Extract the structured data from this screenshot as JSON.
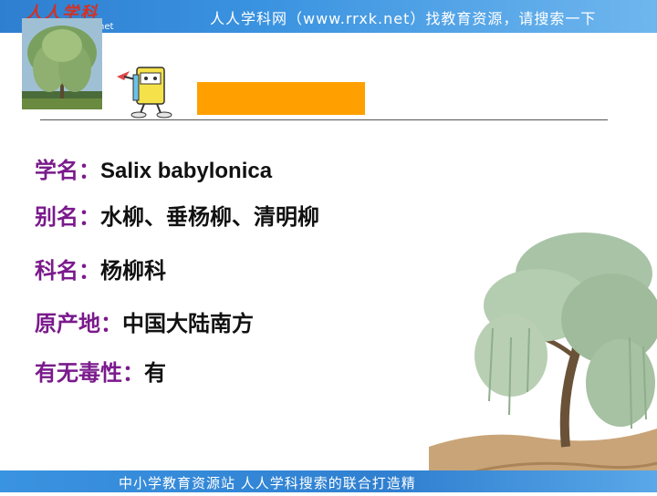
{
  "header": {
    "logo_text": "人人学科",
    "logo_net": "net",
    "banner_text": "人人学科网（www.rrxk.net）找教育资源，请搜索一下"
  },
  "info": [
    {
      "label": "学名：",
      "value": "Salix babylonica"
    },
    {
      "label": "别名：",
      "value": "水柳、垂杨柳、清明柳"
    },
    {
      "label": "科名：",
      "value": "杨柳科"
    },
    {
      "label": "原产地：",
      "value": "中国大陆南方"
    },
    {
      "label": "有无毒性：",
      "value": "有"
    }
  ],
  "footer": {
    "banner_text": "中小学教育资源站  人人学科搜索的联合打造精"
  },
  "colors": {
    "accent_bar": "#ffa000",
    "label": "#7a1a8c",
    "banner": "#2f7fd0"
  }
}
